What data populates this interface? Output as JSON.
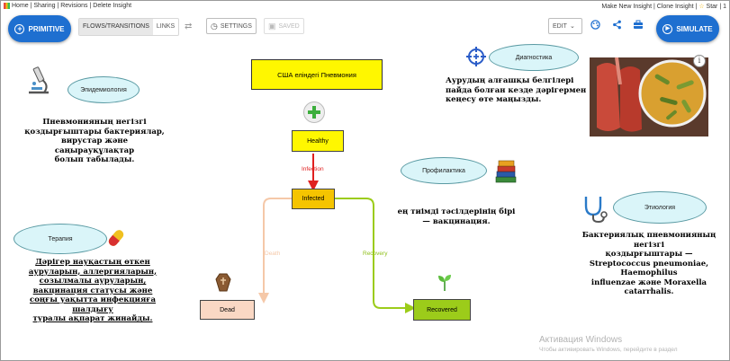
{
  "topbar": {
    "left_links": "Home | Sharing | Revisions | Delete Insight",
    "right_links": "Make New Insight | Clone Insight | ",
    "star_label": "Star",
    "star_count": "| 1"
  },
  "toolbar": {
    "primitive_label": "PRIMITIVE",
    "tab_flows": "FLOWS/TRANSITIONS",
    "tab_links": "LINKS",
    "settings_label": "SETTINGS",
    "saved_label": "SAVED",
    "edit_label": "EDIT",
    "simulate_label": "SIMULATE"
  },
  "diagram": {
    "title": "США еліндегі Пневмония",
    "stocks": {
      "healthy": "Healthy",
      "infected": "Infected",
      "dead": "Dead",
      "recovered": "Recovered"
    },
    "flows": {
      "infection": "Infection",
      "death": "Death",
      "recovery": "Recovery"
    },
    "ellipses": {
      "epidemiology": "Эпидемиология",
      "diagnostics": "Диагностика",
      "prophylaxis": "Профилактика",
      "etiology": "Этиология",
      "therapy": "Терапия"
    },
    "notes": {
      "epidemiology": [
        "Пневмонияның негізгі",
        "қоздырғыштары бактериялар,",
        "вирустар және саңырауқұлақтар",
        "болып табылады."
      ],
      "diagnostics": [
        "Аурудың алғашқы белгілері",
        "пайда болған кезде дәрігермен",
        "кеңесу өте маңызды."
      ],
      "prophylaxis": [
        "ең тиімді тәсілдерінің бірі",
        "— вакцинация."
      ],
      "etiology": [
        "Бактериялық пневмонияның негізгі",
        "қоздырғыштары —",
        "Streptococcus pneumoniae, Haemophilus",
        "influenzae және Moraxella catarrhalis."
      ],
      "therapy": [
        "Дәрігер науқастың өткен",
        "ауруларын, аллергияларын,",
        "созылмалы ауруларын,",
        "вакцинация статусы және",
        "соңғы уақытта инфекцияға",
        "шалдығу",
        "туралы ақпарат жинайды."
      ]
    },
    "icons": [
      "microscope-icon",
      "target-icon",
      "books-icon",
      "stethoscope-icon",
      "pill-icon",
      "coffin-icon",
      "sprout-icon",
      "plus-icon",
      "info-icon"
    ]
  },
  "watermark": {
    "line1": "Активация Windows",
    "line2": "Чтобы активировать Windows, перейдите в раздел"
  },
  "colors": {
    "accent": "#1e6fd0",
    "ellipse_fill": "#daf5f9",
    "title_fill": "#fff700",
    "healthy_fill": "#fff700",
    "infected_fill": "#f5c400",
    "dead_fill": "#fad8c4",
    "recovered_fill": "#9ccc1a",
    "infection_flow": "#e02020",
    "death_flow": "#f5c8a8",
    "recovery_flow": "#9ccc1a"
  }
}
